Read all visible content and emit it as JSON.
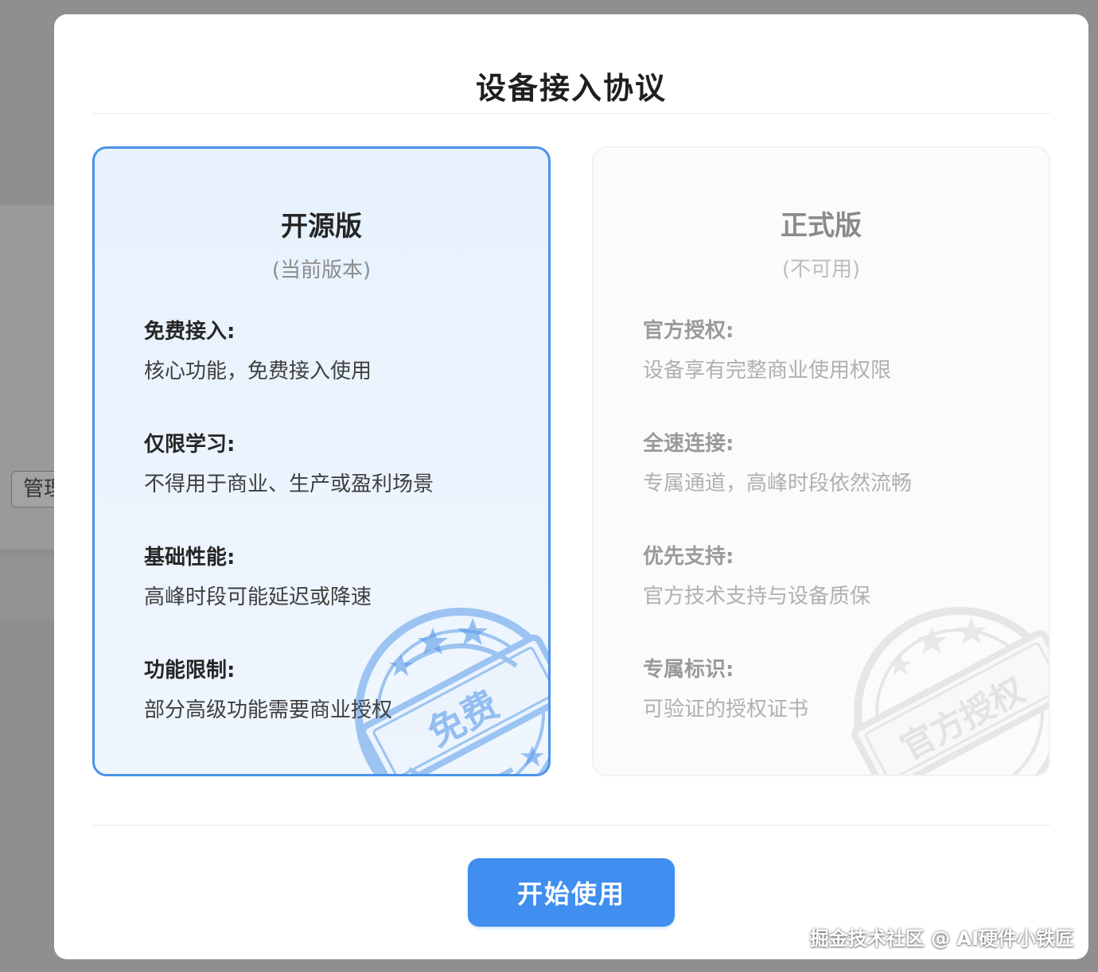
{
  "background": {
    "button_label": "管理"
  },
  "modal": {
    "title": "设备接入协议",
    "start_button": "开始使用"
  },
  "cards": {
    "free": {
      "title": "开源版",
      "subtitle": "(当前版本)",
      "stamp_text": "免费",
      "features": [
        {
          "label": "免费接入:",
          "desc": "核心功能，免费接入使用"
        },
        {
          "label": "仅限学习:",
          "desc": "不得用于商业、生产或盈利场景"
        },
        {
          "label": "基础性能:",
          "desc": "高峰时段可能延迟或降速"
        },
        {
          "label": "功能限制:",
          "desc": "部分高级功能需要商业授权"
        }
      ]
    },
    "pro": {
      "title": "正式版",
      "subtitle": "(不可用)",
      "stamp_text": "官方授权",
      "features": [
        {
          "label": "官方授权:",
          "desc": "设备享有完整商业使用权限"
        },
        {
          "label": "全速连接:",
          "desc": "专属通道，高峰时段依然流畅"
        },
        {
          "label": "优先支持:",
          "desc": "官方技术支持与设备质保"
        },
        {
          "label": "专属标识:",
          "desc": "可验证的授权证书"
        }
      ]
    }
  },
  "watermark": "掘金技术社区 @ AI硬件小铁匠",
  "colors": {
    "accent": "#3f8ef0",
    "card_border_active": "#4b93e8",
    "stamp_blue": "#5a9be8",
    "stamp_grey": "#e6e6e6"
  }
}
